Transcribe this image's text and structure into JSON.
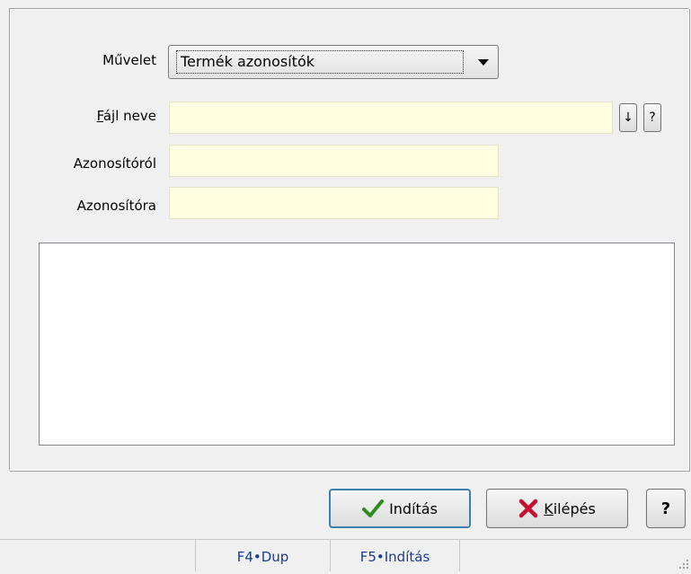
{
  "form": {
    "muvelet_label": "Művelet",
    "muvelet_value": "Termék azonosítók",
    "fajl_label_first": "F",
    "fajl_label_rest": "ájl neve",
    "fajl_value": "",
    "azonositorol_label": "Azonosítóról",
    "azonositorol_value": "",
    "azonositora_label": "Azonosítóra",
    "azonositora_value": "",
    "browse_btn": "↓",
    "help_small_btn": "?"
  },
  "buttons": {
    "inditas": "Indítás",
    "kilepes_first": "K",
    "kilepes_rest": "ilépés",
    "help": "?"
  },
  "statusbar": {
    "f4": "F4•Dup",
    "f5": "F5•Indítás"
  },
  "colors": {
    "field_bg": "#ffffe1",
    "default_border": "#3c7fb1",
    "status_text": "#1a3d8f",
    "check_green": "#2e8b1e",
    "x_red": "#c8102e"
  },
  "icons": {
    "inditas": "checkmark-icon",
    "kilepes": "x-icon",
    "combo": "chevron-down-icon"
  }
}
